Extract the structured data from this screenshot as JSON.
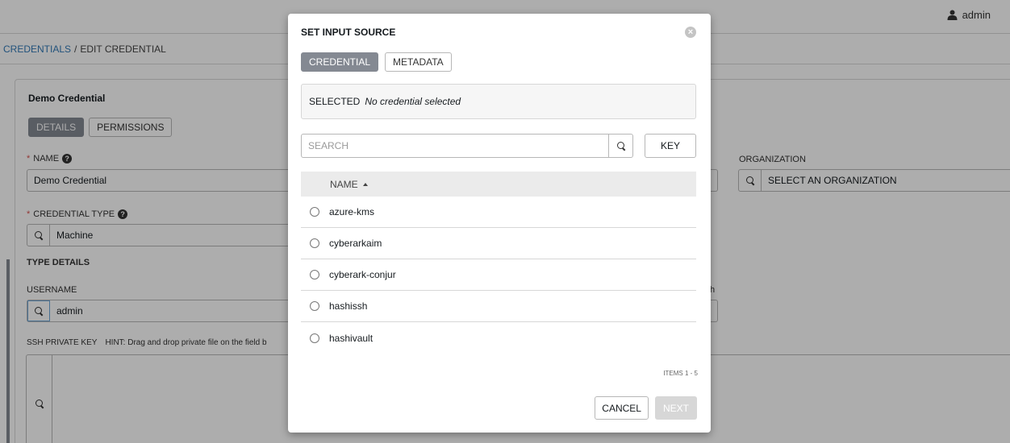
{
  "header": {
    "username": "admin"
  },
  "breadcrumb": {
    "credentials": "CREDENTIALS",
    "separator": "/",
    "current": "EDIT CREDENTIAL"
  },
  "form": {
    "title": "Demo Credential",
    "tabs": {
      "details": "DETAILS",
      "permissions": "PERMISSIONS"
    },
    "name_label": "NAME",
    "name_value": "Demo Credential",
    "organization_label": "ORGANIZATION",
    "organization_placeholder": "SELECT AN ORGANIZATION",
    "credential_type_label": "CREDENTIAL TYPE",
    "credential_type_value": "Machine",
    "type_details_label": "TYPE DETAILS",
    "username_label": "USERNAME",
    "username_value": "admin",
    "truncated_label_fragment": "h",
    "ssh_label": "SSH PRIVATE KEY",
    "ssh_hint": "HINT: Drag and drop private file on the field b"
  },
  "modal": {
    "title": "SET INPUT SOURCE",
    "tabs": {
      "credential": "CREDENTIAL",
      "metadata": "METADATA"
    },
    "selected_label": "SELECTED",
    "selected_value": "No credential selected",
    "search_placeholder": "SEARCH",
    "key_button": "KEY",
    "column_name": "NAME",
    "items": [
      {
        "name": "azure-kms"
      },
      {
        "name": "cyberarkaim"
      },
      {
        "name": "cyberark-conjur"
      },
      {
        "name": "hashissh"
      },
      {
        "name": "hashivault"
      }
    ],
    "items_count": "ITEMS  1 - 5",
    "cancel_button": "CANCEL",
    "next_button": "NEXT"
  },
  "colors": {
    "link": "#337ab7",
    "active_tab": "#848992",
    "required": "#d9534f",
    "disabled_button": "#d7d7d7"
  },
  "icons": {
    "user": "user-icon",
    "search": "search-icon",
    "help": "help-icon",
    "close": "close-icon",
    "sort": "sort-up-icon"
  }
}
